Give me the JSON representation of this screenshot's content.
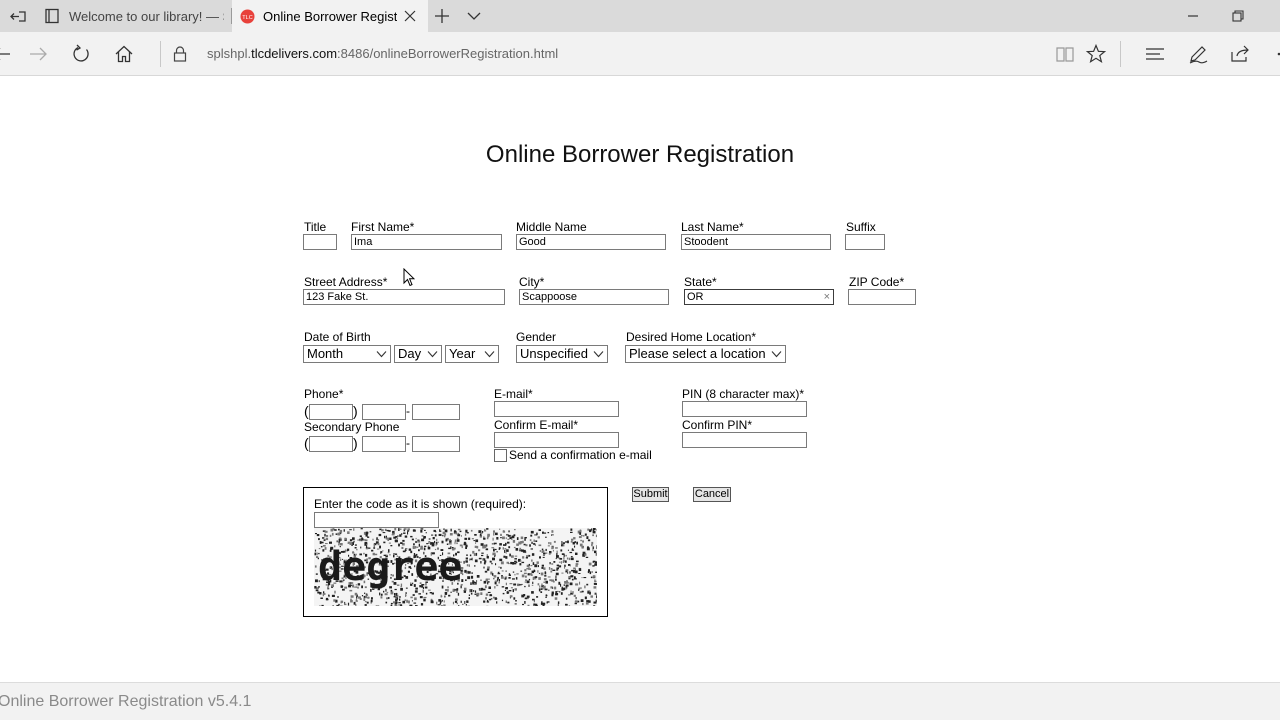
{
  "browser": {
    "tabs": [
      {
        "title": "Welcome to our library! — S",
        "icon": "book-icon"
      },
      {
        "title": "Online Borrower Registr",
        "icon": "tlc-favicon-icon",
        "active": true
      }
    ],
    "url": {
      "prefix": "splshpl.",
      "domain": "tlcdelivers.com",
      "suffix": ":8486/onlineBorrowerRegistration.html"
    },
    "accent": "#e8413b"
  },
  "page": {
    "title": "Online Borrower Registration",
    "footer": "Online Borrower Registration v5.4.1"
  },
  "form": {
    "title_label": "Title",
    "first_name_label": "First Name*",
    "first_name_value": "Ima",
    "middle_name_label": "Middle Name",
    "middle_name_value": "Good",
    "last_name_label": "Last Name*",
    "last_name_value": "Stoodent",
    "suffix_label": "Suffix",
    "street_label": "Street Address*",
    "street_value": "123 Fake St.",
    "city_label": "City*",
    "city_value": "Scappoose",
    "state_label": "State*",
    "state_value": "OR",
    "zip_label": "ZIP Code*",
    "dob_label": "Date of Birth",
    "dob_month": "Month",
    "dob_day": "Day",
    "dob_year": "Year",
    "gender_label": "Gender",
    "gender_value": "Unspecified",
    "location_label": "Desired Home Location*",
    "location_value": "Please select a location",
    "phone_label": "Phone*",
    "secondary_phone_label": "Secondary Phone",
    "email_label": "E-mail*",
    "confirm_email_label": "Confirm E-mail*",
    "send_confirmation_label": "Send a confirmation e-mail",
    "pin_label": "PIN (8 character max)*",
    "confirm_pin_label": "Confirm PIN*",
    "submit_label": "Submit",
    "cancel_label": "Cancel",
    "captcha_label": "Enter the code as it is shown (required):",
    "captcha_word": "degree",
    "paren_open": "(",
    "paren_close": ")",
    "dash": "-"
  }
}
